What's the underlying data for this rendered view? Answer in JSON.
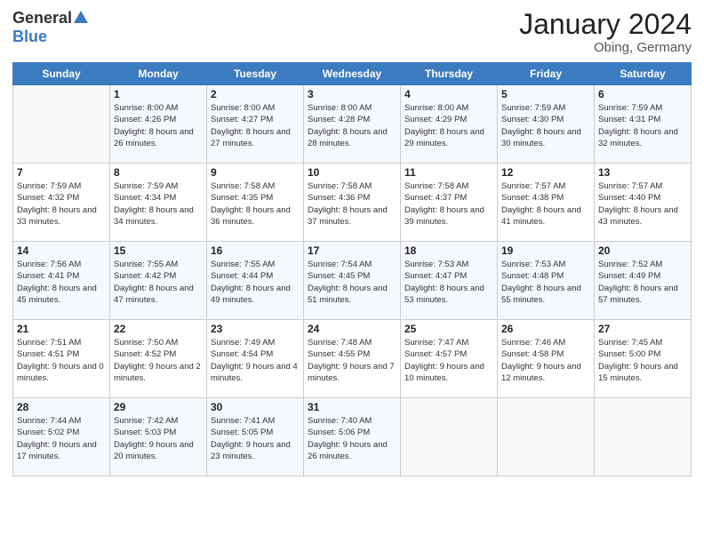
{
  "header": {
    "logo_general": "General",
    "logo_blue": "Blue",
    "main_title": "January 2024",
    "subtitle": "Obing, Germany"
  },
  "days_of_week": [
    "Sunday",
    "Monday",
    "Tuesday",
    "Wednesday",
    "Thursday",
    "Friday",
    "Saturday"
  ],
  "weeks": [
    [
      {
        "num": "",
        "sunrise": "",
        "sunset": "",
        "daylight": ""
      },
      {
        "num": "1",
        "sunrise": "Sunrise: 8:00 AM",
        "sunset": "Sunset: 4:26 PM",
        "daylight": "Daylight: 8 hours and 26 minutes."
      },
      {
        "num": "2",
        "sunrise": "Sunrise: 8:00 AM",
        "sunset": "Sunset: 4:27 PM",
        "daylight": "Daylight: 8 hours and 27 minutes."
      },
      {
        "num": "3",
        "sunrise": "Sunrise: 8:00 AM",
        "sunset": "Sunset: 4:28 PM",
        "daylight": "Daylight: 8 hours and 28 minutes."
      },
      {
        "num": "4",
        "sunrise": "Sunrise: 8:00 AM",
        "sunset": "Sunset: 4:29 PM",
        "daylight": "Daylight: 8 hours and 29 minutes."
      },
      {
        "num": "5",
        "sunrise": "Sunrise: 7:59 AM",
        "sunset": "Sunset: 4:30 PM",
        "daylight": "Daylight: 8 hours and 30 minutes."
      },
      {
        "num": "6",
        "sunrise": "Sunrise: 7:59 AM",
        "sunset": "Sunset: 4:31 PM",
        "daylight": "Daylight: 8 hours and 32 minutes."
      }
    ],
    [
      {
        "num": "7",
        "sunrise": "Sunrise: 7:59 AM",
        "sunset": "Sunset: 4:32 PM",
        "daylight": "Daylight: 8 hours and 33 minutes."
      },
      {
        "num": "8",
        "sunrise": "Sunrise: 7:59 AM",
        "sunset": "Sunset: 4:34 PM",
        "daylight": "Daylight: 8 hours and 34 minutes."
      },
      {
        "num": "9",
        "sunrise": "Sunrise: 7:58 AM",
        "sunset": "Sunset: 4:35 PM",
        "daylight": "Daylight: 8 hours and 36 minutes."
      },
      {
        "num": "10",
        "sunrise": "Sunrise: 7:58 AM",
        "sunset": "Sunset: 4:36 PM",
        "daylight": "Daylight: 8 hours and 37 minutes."
      },
      {
        "num": "11",
        "sunrise": "Sunrise: 7:58 AM",
        "sunset": "Sunset: 4:37 PM",
        "daylight": "Daylight: 8 hours and 39 minutes."
      },
      {
        "num": "12",
        "sunrise": "Sunrise: 7:57 AM",
        "sunset": "Sunset: 4:38 PM",
        "daylight": "Daylight: 8 hours and 41 minutes."
      },
      {
        "num": "13",
        "sunrise": "Sunrise: 7:57 AM",
        "sunset": "Sunset: 4:40 PM",
        "daylight": "Daylight: 8 hours and 43 minutes."
      }
    ],
    [
      {
        "num": "14",
        "sunrise": "Sunrise: 7:56 AM",
        "sunset": "Sunset: 4:41 PM",
        "daylight": "Daylight: 8 hours and 45 minutes."
      },
      {
        "num": "15",
        "sunrise": "Sunrise: 7:55 AM",
        "sunset": "Sunset: 4:42 PM",
        "daylight": "Daylight: 8 hours and 47 minutes."
      },
      {
        "num": "16",
        "sunrise": "Sunrise: 7:55 AM",
        "sunset": "Sunset: 4:44 PM",
        "daylight": "Daylight: 8 hours and 49 minutes."
      },
      {
        "num": "17",
        "sunrise": "Sunrise: 7:54 AM",
        "sunset": "Sunset: 4:45 PM",
        "daylight": "Daylight: 8 hours and 51 minutes."
      },
      {
        "num": "18",
        "sunrise": "Sunrise: 7:53 AM",
        "sunset": "Sunset: 4:47 PM",
        "daylight": "Daylight: 8 hours and 53 minutes."
      },
      {
        "num": "19",
        "sunrise": "Sunrise: 7:53 AM",
        "sunset": "Sunset: 4:48 PM",
        "daylight": "Daylight: 8 hours and 55 minutes."
      },
      {
        "num": "20",
        "sunrise": "Sunrise: 7:52 AM",
        "sunset": "Sunset: 4:49 PM",
        "daylight": "Daylight: 8 hours and 57 minutes."
      }
    ],
    [
      {
        "num": "21",
        "sunrise": "Sunrise: 7:51 AM",
        "sunset": "Sunset: 4:51 PM",
        "daylight": "Daylight: 9 hours and 0 minutes."
      },
      {
        "num": "22",
        "sunrise": "Sunrise: 7:50 AM",
        "sunset": "Sunset: 4:52 PM",
        "daylight": "Daylight: 9 hours and 2 minutes."
      },
      {
        "num": "23",
        "sunrise": "Sunrise: 7:49 AM",
        "sunset": "Sunset: 4:54 PM",
        "daylight": "Daylight: 9 hours and 4 minutes."
      },
      {
        "num": "24",
        "sunrise": "Sunrise: 7:48 AM",
        "sunset": "Sunset: 4:55 PM",
        "daylight": "Daylight: 9 hours and 7 minutes."
      },
      {
        "num": "25",
        "sunrise": "Sunrise: 7:47 AM",
        "sunset": "Sunset: 4:57 PM",
        "daylight": "Daylight: 9 hours and 10 minutes."
      },
      {
        "num": "26",
        "sunrise": "Sunrise: 7:46 AM",
        "sunset": "Sunset: 4:58 PM",
        "daylight": "Daylight: 9 hours and 12 minutes."
      },
      {
        "num": "27",
        "sunrise": "Sunrise: 7:45 AM",
        "sunset": "Sunset: 5:00 PM",
        "daylight": "Daylight: 9 hours and 15 minutes."
      }
    ],
    [
      {
        "num": "28",
        "sunrise": "Sunrise: 7:44 AM",
        "sunset": "Sunset: 5:02 PM",
        "daylight": "Daylight: 9 hours and 17 minutes."
      },
      {
        "num": "29",
        "sunrise": "Sunrise: 7:42 AM",
        "sunset": "Sunset: 5:03 PM",
        "daylight": "Daylight: 9 hours and 20 minutes."
      },
      {
        "num": "30",
        "sunrise": "Sunrise: 7:41 AM",
        "sunset": "Sunset: 5:05 PM",
        "daylight": "Daylight: 9 hours and 23 minutes."
      },
      {
        "num": "31",
        "sunrise": "Sunrise: 7:40 AM",
        "sunset": "Sunset: 5:06 PM",
        "daylight": "Daylight: 9 hours and 26 minutes."
      },
      {
        "num": "",
        "sunrise": "",
        "sunset": "",
        "daylight": ""
      },
      {
        "num": "",
        "sunrise": "",
        "sunset": "",
        "daylight": ""
      },
      {
        "num": "",
        "sunrise": "",
        "sunset": "",
        "daylight": ""
      }
    ]
  ]
}
